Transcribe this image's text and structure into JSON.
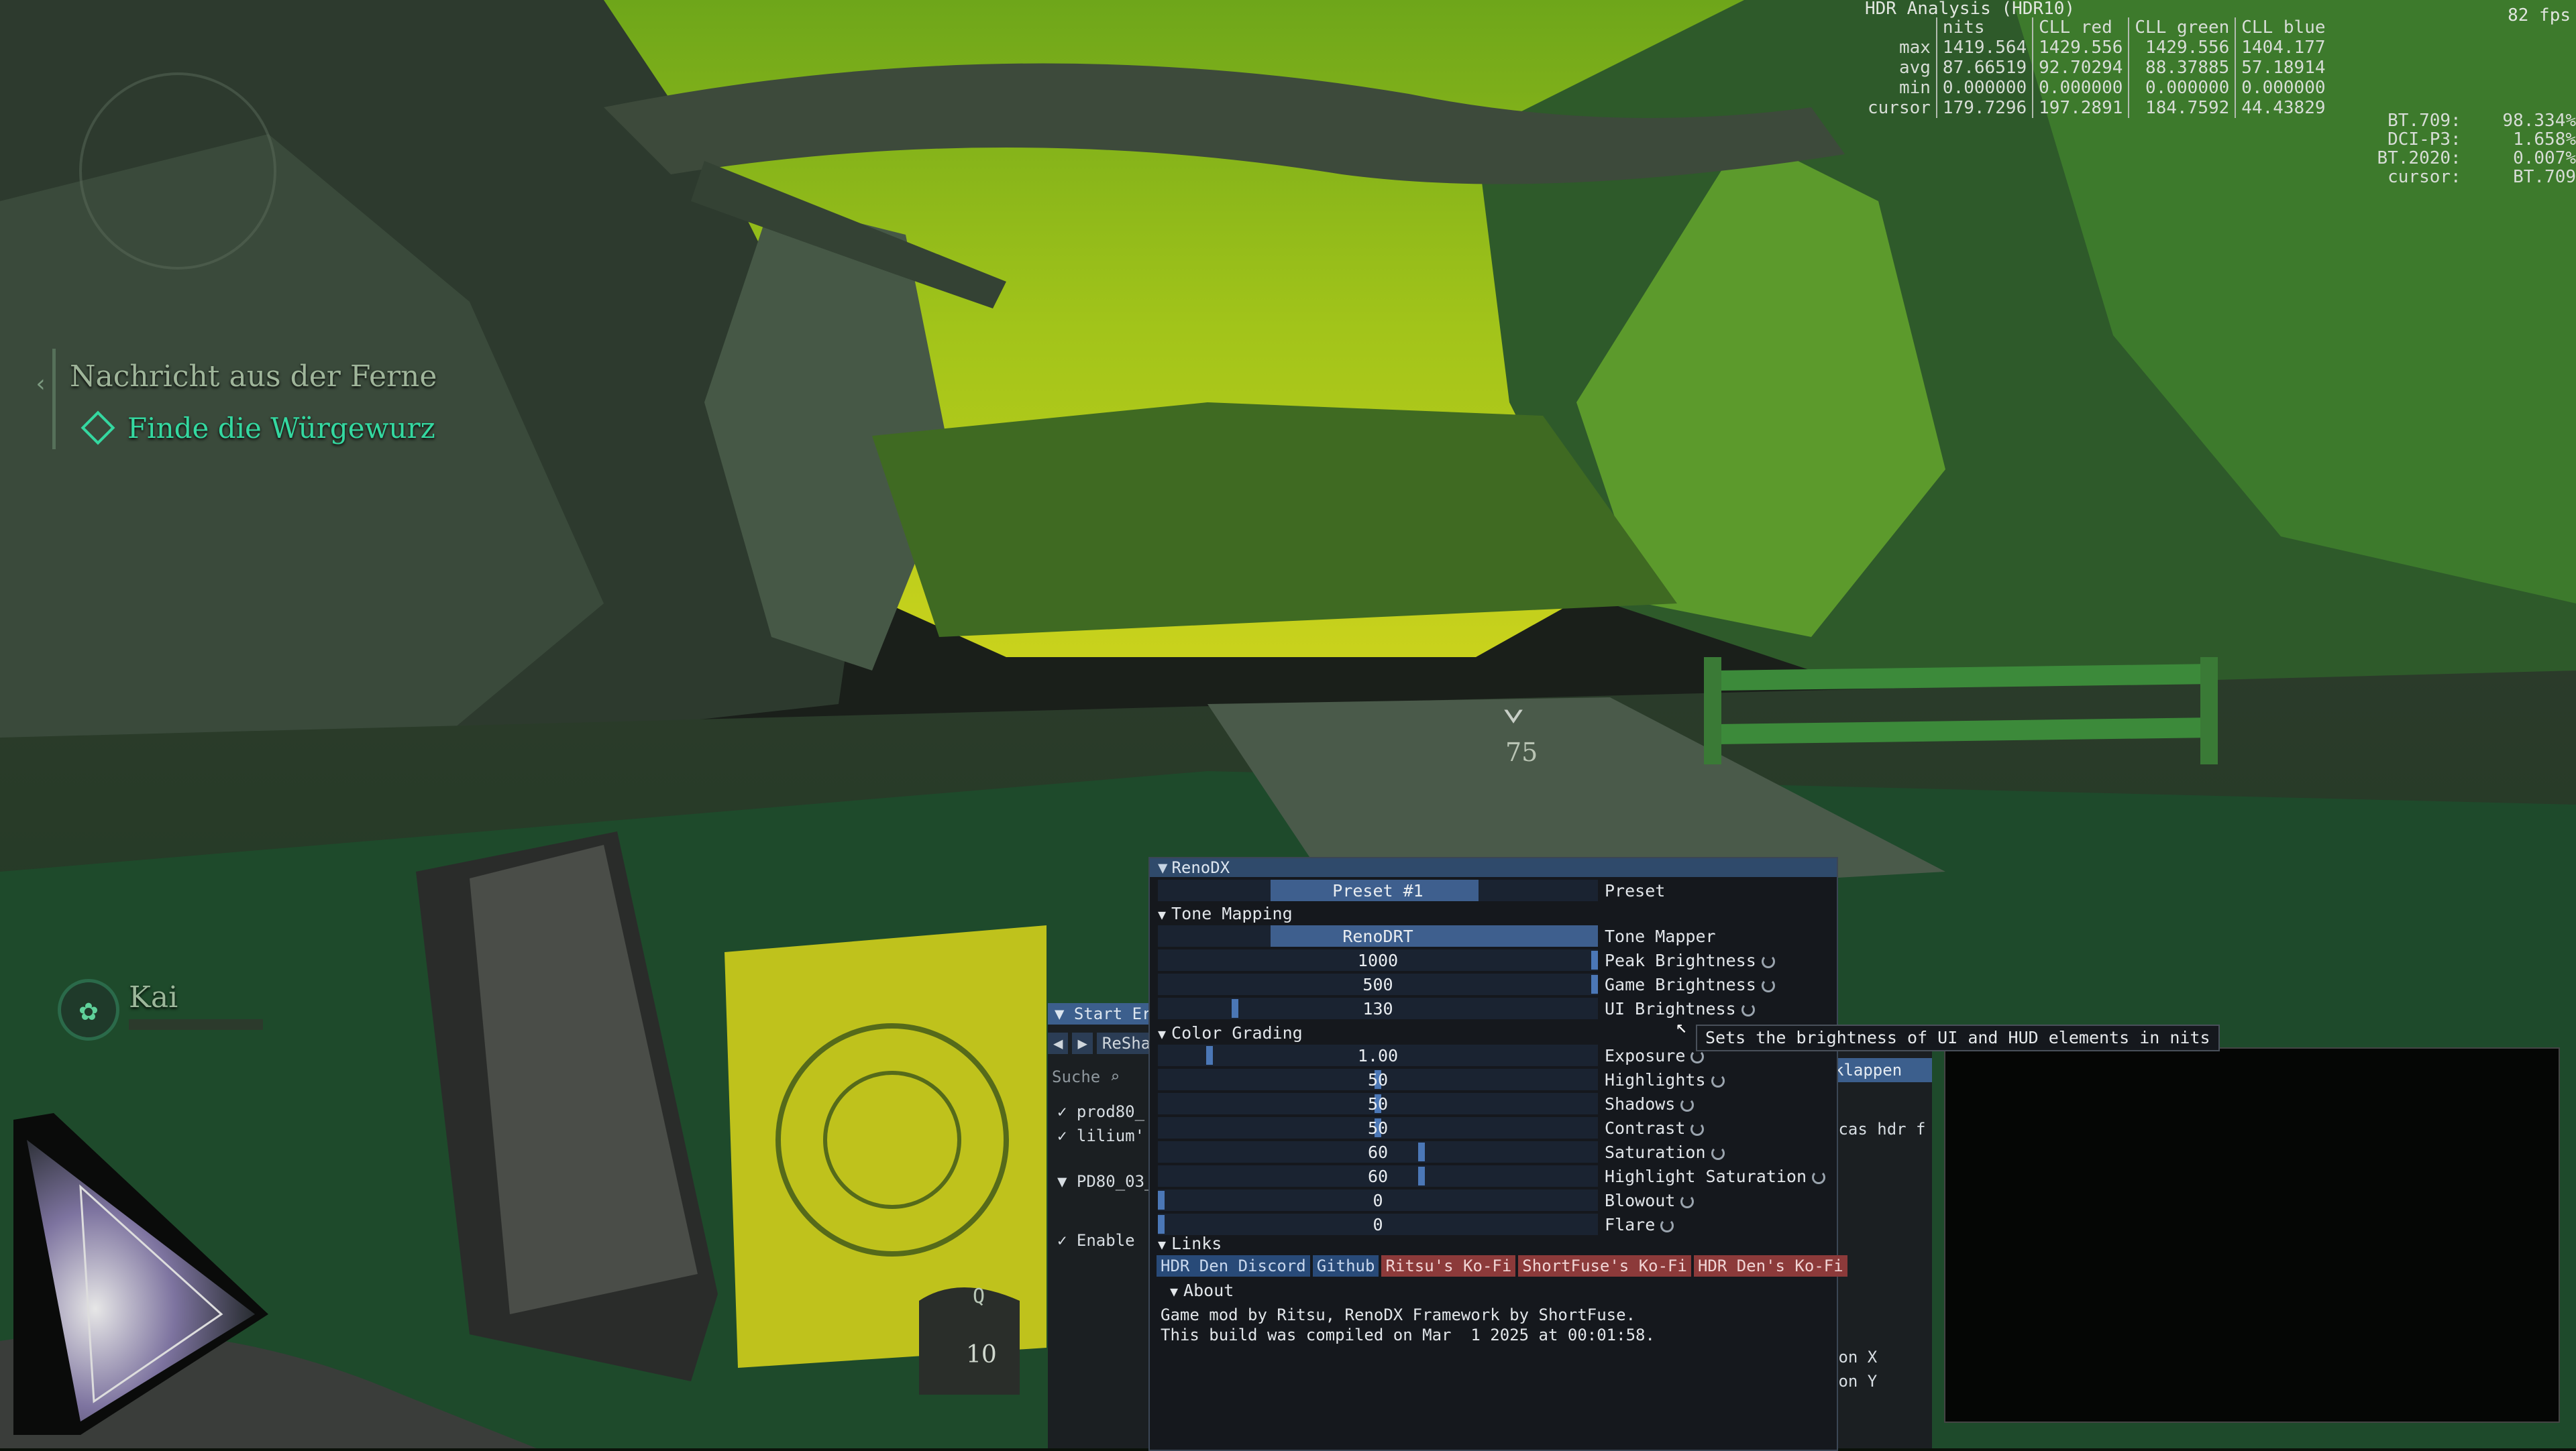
{
  "game_hud": {
    "quest_title": "Nachricht aus der Ferne",
    "quest_objective": "Finde die Würgewurz",
    "compass_distance": "75",
    "companion_name": "Kai",
    "slot_key": "Q",
    "slot_count": "10"
  },
  "hdr_analysis": {
    "title": "HDR Analysis (HDR10)",
    "fps": "82 fps",
    "columns": [
      "nits",
      "CLL red",
      "CLL green",
      "CLL blue"
    ],
    "rows": [
      {
        "label": "max",
        "values": [
          "1419.564",
          "1429.556",
          "1429.556",
          "1404.177"
        ]
      },
      {
        "label": "avg",
        "values": [
          "87.66519",
          "92.70294",
          "88.37885",
          "57.18914"
        ]
      },
      {
        "label": "min",
        "values": [
          "0.000000",
          "0.000000",
          "0.000000",
          "0.000000"
        ]
      },
      {
        "label": "cursor",
        "values": [
          "179.7296",
          "197.2891",
          "184.7592",
          "44.43829"
        ]
      }
    ],
    "gamut": [
      {
        "label": "BT.709:",
        "value": "98.334%"
      },
      {
        "label": "DCI-P3:",
        "value": "1.658%"
      },
      {
        "label": "BT.2020:",
        "value": "0.007%"
      },
      {
        "label": "cursor:",
        "value": "BT.709"
      }
    ]
  },
  "reshade": {
    "title": "Start Er",
    "nav_label": "ReSha",
    "search_placeholder": "Suche",
    "items": [
      "prod80_",
      "lilium'",
      "PD80_03_",
      "Enable"
    ],
    "right_button": "klappen",
    "right_items": [
      "ecas hdr f",
      "ion X",
      "ion Y"
    ]
  },
  "renodx": {
    "title": "RenoDX",
    "preset": {
      "value": "Preset #1",
      "label": "Preset"
    },
    "tone_mapping": {
      "section": "Tone Mapping",
      "rows": [
        {
          "value": "RenoDRT",
          "label": "Tone Mapper",
          "fill": 1.0
        },
        {
          "value": "1000",
          "label": "Peak Brightness",
          "fill": 0.99
        },
        {
          "value": "500",
          "label": "Game Brightness",
          "fill": 0.99
        },
        {
          "value": "130",
          "label": "UI Brightness",
          "fill": 0.07
        }
      ]
    },
    "color_grading": {
      "section": "Color Grading",
      "rows": [
        {
          "value": "1.00",
          "label": "Exposure",
          "fill": 0.05
        },
        {
          "value": "50",
          "label": "Highlights",
          "fill": 0.5
        },
        {
          "value": "50",
          "label": "Shadows",
          "fill": 0.5
        },
        {
          "value": "50",
          "label": "Contrast",
          "fill": 0.5
        },
        {
          "value": "60",
          "label": "Saturation",
          "fill": 0.6
        },
        {
          "value": "60",
          "label": "Highlight Saturation",
          "fill": 0.6
        },
        {
          "value": "0",
          "label": "Blowout",
          "fill": 0.0
        },
        {
          "value": "0",
          "label": "Flare",
          "fill": 0.0
        }
      ]
    },
    "links": {
      "section": "Links",
      "items": [
        {
          "label": "HDR Den Discord",
          "style": "blue"
        },
        {
          "label": "Github",
          "style": "blue"
        },
        {
          "label": "Ritsu's Ko-Fi",
          "style": "red"
        },
        {
          "label": "ShortFuse's Ko-Fi",
          "style": "red"
        },
        {
          "label": "HDR Den's Ko-Fi",
          "style": "red"
        }
      ]
    },
    "about": {
      "section": "About",
      "line1": "Game mod by Ritsu, RenoDX Framework by ShortFuse.",
      "line2": "This build was compiled on Mar  1 2025 at 00:01:58."
    },
    "tooltip": "Sets the brightness of UI and HUD elements in nits"
  }
}
